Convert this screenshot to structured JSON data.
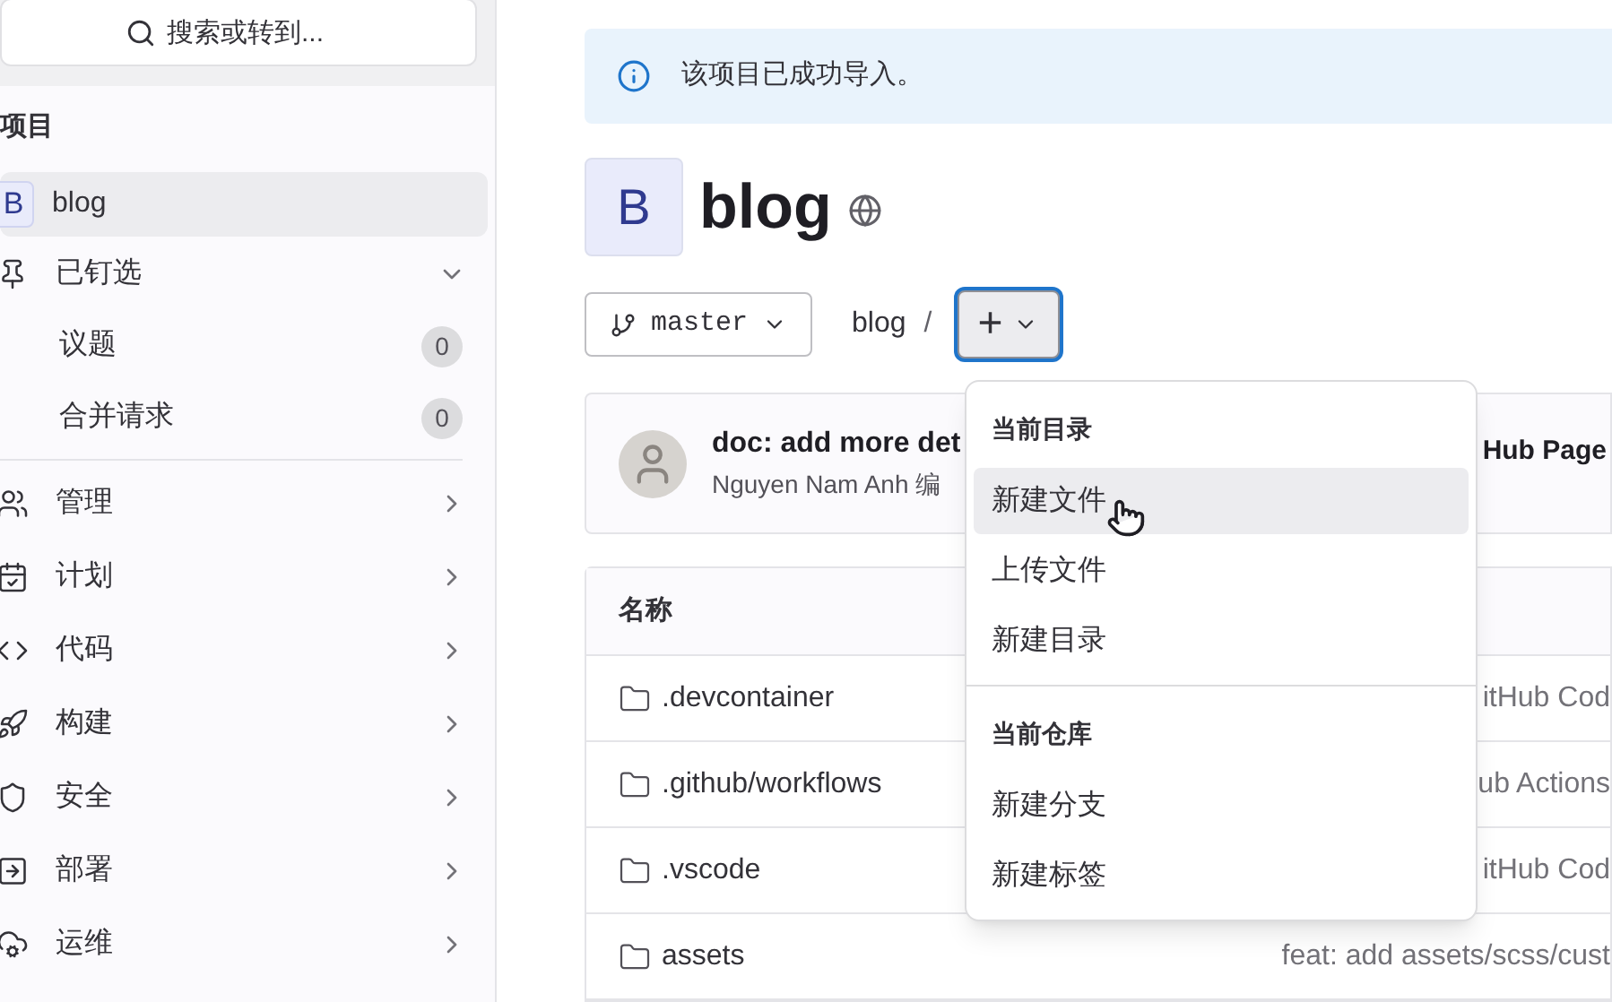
{
  "sidebar": {
    "search": {
      "placeholder": "搜索或转到..."
    },
    "section_title": "项目",
    "items": [
      {
        "kind": "project",
        "avatar": "B",
        "label": "blog",
        "selected": true
      },
      {
        "kind": "group",
        "label": "已钉选",
        "selected": false,
        "expanded": true,
        "children": [
          {
            "label": "议题",
            "count": "0"
          },
          {
            "label": "合并请求",
            "count": "0"
          }
        ]
      },
      {
        "kind": "nav",
        "label": "管理",
        "selected": false
      },
      {
        "kind": "nav",
        "label": "计划",
        "selected": false
      },
      {
        "kind": "nav",
        "label": "代码",
        "selected": false
      },
      {
        "kind": "nav",
        "label": "构建",
        "selected": false
      },
      {
        "kind": "nav",
        "label": "安全",
        "selected": false
      },
      {
        "kind": "nav",
        "label": "部署",
        "selected": false
      },
      {
        "kind": "nav",
        "label": "运维",
        "selected": false
      }
    ]
  },
  "alert": {
    "text": "该项目已成功导入。"
  },
  "project": {
    "avatar": "B",
    "name": "blog"
  },
  "toolbar": {
    "branch": "master",
    "path": "blog",
    "separator": "/",
    "add_button": {
      "label": "+",
      "expanded": true
    }
  },
  "dropdown": {
    "sections": [
      {
        "heading": "当前目录",
        "items": [
          {
            "label": "新建文件",
            "highlighted": true
          },
          {
            "label": "上传文件",
            "highlighted": false
          },
          {
            "label": "新建目录",
            "highlighted": false
          }
        ]
      },
      {
        "heading": "当前仓库",
        "items": [
          {
            "label": "新建分支",
            "highlighted": false
          },
          {
            "label": "新建标签",
            "highlighted": false
          }
        ]
      }
    ]
  },
  "commit": {
    "title": "doc: add more det",
    "title_right": "Hub Page",
    "author": "Nguyen Nam Anh 编"
  },
  "table": {
    "columns": [
      "名称"
    ],
    "rows": [
      {
        "name": ".devcontainer",
        "last_commit": "itHub Cod"
      },
      {
        "name": ".github/workflows",
        "last_commit": "ub Actions"
      },
      {
        "name": ".vscode",
        "last_commit": "itHub Cod"
      },
      {
        "name": "assets",
        "last_commit": "feat: add assets/scss/cust"
      }
    ]
  }
}
